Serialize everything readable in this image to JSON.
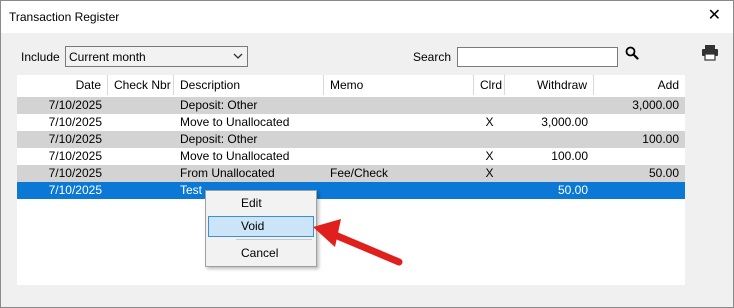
{
  "window": {
    "title": "Transaction Register",
    "close_glyph": "✕"
  },
  "toolbar": {
    "include_label": "Include",
    "include_value": "Current month",
    "search_label": "Search",
    "search_value": "",
    "search_icon": "search-icon",
    "print_icon": "printer-icon"
  },
  "table": {
    "columns": [
      "Date",
      "Check Nbr",
      "Description",
      "Memo",
      "Clrd",
      "Withdraw",
      "Add"
    ],
    "rows": [
      {
        "date": "7/10/2025",
        "check": "",
        "desc": "Deposit: Other",
        "memo": "",
        "clrd": "",
        "withdraw": "",
        "add": "3,000.00"
      },
      {
        "date": "7/10/2025",
        "check": "",
        "desc": "Move to Unallocated",
        "memo": "",
        "clrd": "X",
        "withdraw": "3,000.00",
        "add": ""
      },
      {
        "date": "7/10/2025",
        "check": "",
        "desc": "Deposit: Other",
        "memo": "",
        "clrd": "",
        "withdraw": "",
        "add": "100.00"
      },
      {
        "date": "7/10/2025",
        "check": "",
        "desc": "Move to Unallocated",
        "memo": "",
        "clrd": "X",
        "withdraw": "100.00",
        "add": ""
      },
      {
        "date": "7/10/2025",
        "check": "",
        "desc": "From Unallocated",
        "memo": "Fee/Check",
        "clrd": "X",
        "withdraw": "",
        "add": "50.00"
      },
      {
        "date": "7/10/2025",
        "check": "",
        "desc": "Test",
        "memo": "",
        "clrd": "",
        "withdraw": "50.00",
        "add": ""
      }
    ],
    "selected_row": 5
  },
  "context_menu": {
    "items": [
      "Edit",
      "Void",
      "Cancel"
    ],
    "highlighted": "Void"
  },
  "colors": {
    "alt_row": "#d3d3d3",
    "selected_row": "#0a78d4",
    "menu_highlight": "#cce4f7",
    "arrow": "#e0201c"
  }
}
